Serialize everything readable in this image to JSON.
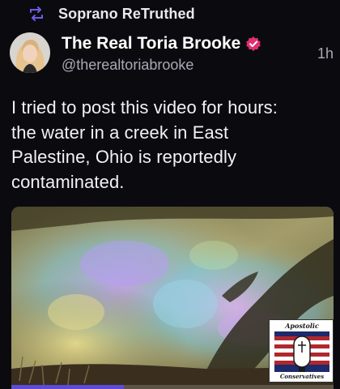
{
  "retruth": {
    "icon": "retruth-icon",
    "label": "Soprano ReTruthed"
  },
  "author": {
    "name": "The Real Toria Brooke",
    "handle": "@therealtoriabrooke",
    "verified_icon": "verified-badge-icon",
    "timestamp": "1h"
  },
  "post": {
    "text_lines": [
      "I tried to post this video for hours:",
      "the water in a creek in East",
      "Palestine, Ohio is reportedly",
      "contaminated."
    ]
  },
  "media": {
    "type": "video",
    "progress": 0.35
  },
  "watermark": {
    "top_text": "Apostolic",
    "bottom_text": "Conservatives"
  },
  "colors": {
    "background": "#0b0b0f",
    "text_primary": "#ffffff",
    "text_secondary": "#a9a9b6",
    "verified": "#e0306f",
    "progress": "#5b4bd6"
  }
}
